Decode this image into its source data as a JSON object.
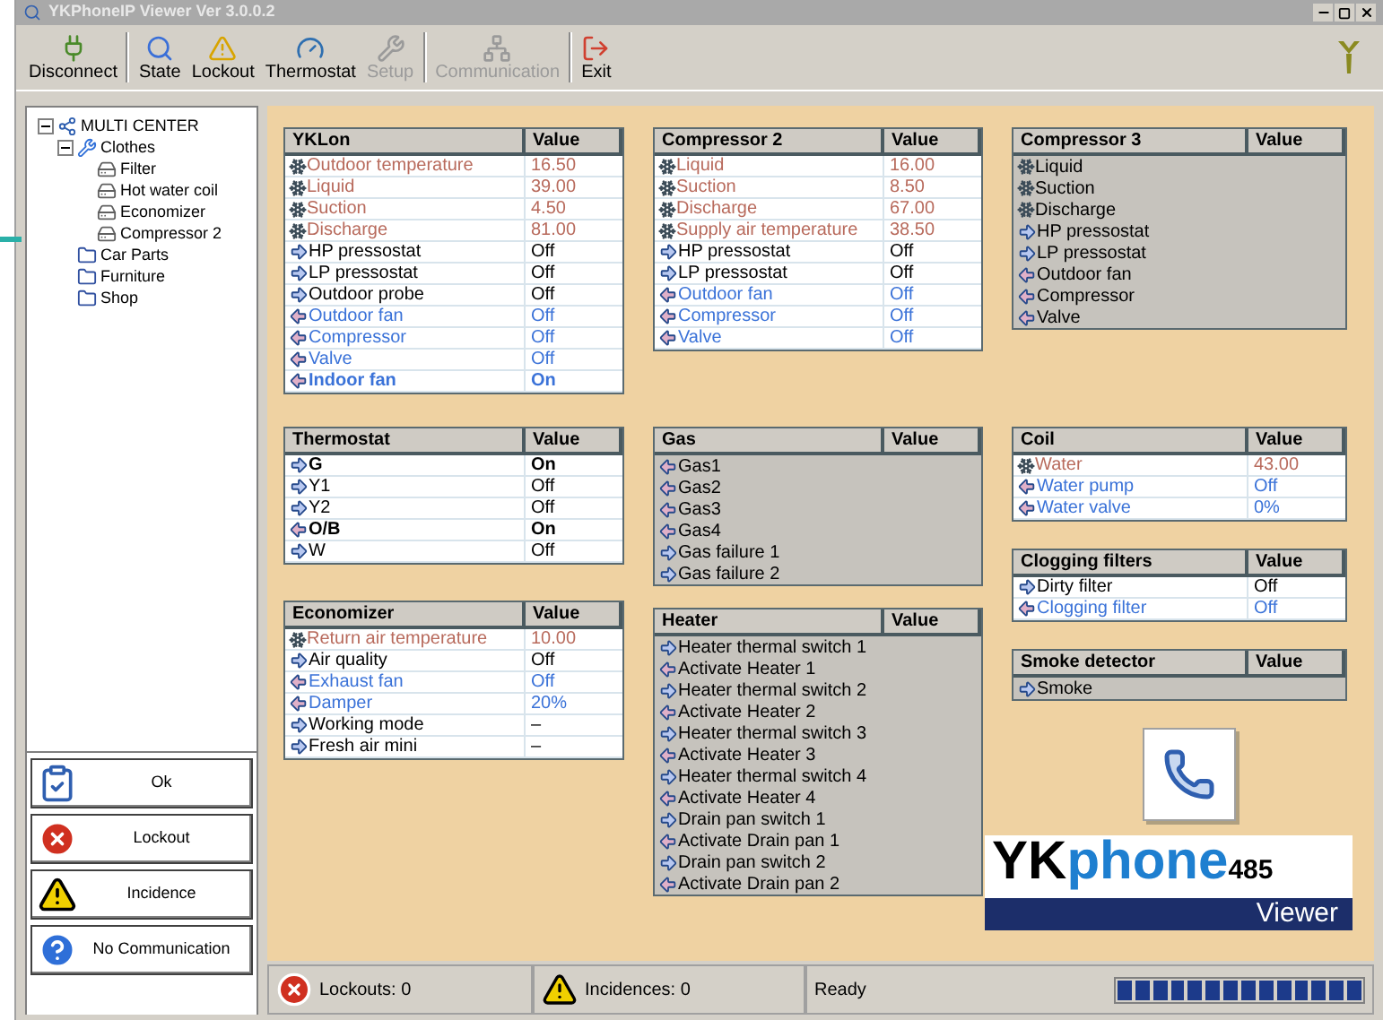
{
  "window": {
    "title": "YKPhoneIP Viewer Ver 3.0.0.2"
  },
  "toolbar": [
    {
      "label": "Disconnect",
      "kind": "disconnect",
      "disabled": false,
      "separator_after": true
    },
    {
      "label": "State",
      "kind": "state",
      "disabled": false,
      "separator_after": false
    },
    {
      "label": "Lockout",
      "kind": "lockout",
      "disabled": false,
      "separator_after": false
    },
    {
      "label": "Thermostat",
      "kind": "thermostat",
      "disabled": false,
      "separator_after": false
    },
    {
      "label": "Setup",
      "kind": "setup",
      "disabled": true,
      "separator_after": true
    },
    {
      "label": "Communication",
      "kind": "communication",
      "disabled": true,
      "separator_after": true
    },
    {
      "label": "Exit",
      "kind": "exit",
      "disabled": false,
      "separator_after": false
    }
  ],
  "tree": [
    {
      "label": "MULTI CENTER",
      "kind": "root",
      "expanded": true,
      "children": [
        {
          "label": "Clothes",
          "kind": "group",
          "expanded": true,
          "children": [
            {
              "label": "Filter",
              "kind": "device"
            },
            {
              "label": "Hot water coil",
              "kind": "device"
            },
            {
              "label": "Economizer",
              "kind": "device"
            },
            {
              "label": "Compressor 2",
              "kind": "device"
            }
          ]
        },
        {
          "label": "Car Parts",
          "kind": "site"
        },
        {
          "label": "Furniture",
          "kind": "site"
        },
        {
          "label": "Shop",
          "kind": "site"
        }
      ]
    }
  ],
  "side_buttons": [
    {
      "label": "Ok",
      "kind": "ok"
    },
    {
      "label": "Lockout",
      "kind": "lockout"
    },
    {
      "label": "Incidence",
      "kind": "incidence"
    },
    {
      "label": "No Communication",
      "kind": "nocomm"
    }
  ],
  "top_panels": [
    {
      "title": "YKLon",
      "value_header": "Value",
      "offline": false,
      "rows": [
        {
          "label": "Outdoor temperature",
          "value": "16.50",
          "kind": "sensor",
          "color": "#b86a5c",
          "bold": false
        },
        {
          "label": "Liquid",
          "value": "39.00",
          "kind": "sensor",
          "color": "#b86a5c",
          "bold": false
        },
        {
          "label": "Suction",
          "value": "4.50",
          "kind": "sensor",
          "color": "#b86a5c",
          "bold": false
        },
        {
          "label": "Discharge",
          "value": "81.00",
          "kind": "sensor",
          "color": "#b86a5c",
          "bold": false
        },
        {
          "label": "HP pressostat",
          "value": "Off",
          "kind": "input",
          "color": "#000000",
          "bold": false
        },
        {
          "label": "LP pressostat",
          "value": "Off",
          "kind": "input",
          "color": "#000000",
          "bold": false
        },
        {
          "label": "Outdoor probe",
          "value": "Off",
          "kind": "input",
          "color": "#000000",
          "bold": false
        },
        {
          "label": "Outdoor fan",
          "value": "Off",
          "kind": "output",
          "color": "#3a72d8",
          "bold": false
        },
        {
          "label": "Compressor",
          "value": "Off",
          "kind": "output",
          "color": "#3a72d8",
          "bold": false
        },
        {
          "label": "Valve",
          "value": "Off",
          "kind": "output",
          "color": "#3a72d8",
          "bold": false
        },
        {
          "label": "Indoor fan",
          "value": "On",
          "kind": "output",
          "color": "#3a72d8",
          "bold": true
        }
      ]
    },
    {
      "title": "Compressor 2",
      "value_header": "Value",
      "offline": false,
      "rows": [
        {
          "label": "Liquid",
          "value": "16.00",
          "kind": "sensor",
          "color": "#b86a5c",
          "bold": false
        },
        {
          "label": "Suction",
          "value": "8.50",
          "kind": "sensor",
          "color": "#b86a5c",
          "bold": false
        },
        {
          "label": "Discharge",
          "value": "67.00",
          "kind": "sensor",
          "color": "#b86a5c",
          "bold": false
        },
        {
          "label": "Supply air temperature",
          "value": "38.50",
          "kind": "sensor",
          "color": "#b86a5c",
          "bold": false
        },
        {
          "label": "HP pressostat",
          "value": "Off",
          "kind": "input",
          "color": "#000000",
          "bold": false
        },
        {
          "label": "LP pressostat",
          "value": "Off",
          "kind": "input",
          "color": "#000000",
          "bold": false
        },
        {
          "label": "Outdoor fan",
          "value": "Off",
          "kind": "output",
          "color": "#3a72d8",
          "bold": false
        },
        {
          "label": "Compressor",
          "value": "Off",
          "kind": "output",
          "color": "#3a72d8",
          "bold": false
        },
        {
          "label": "Valve",
          "value": "Off",
          "kind": "output",
          "color": "#3a72d8",
          "bold": false
        }
      ]
    },
    {
      "title": "Compressor 3",
      "value_header": "Value",
      "offline": true,
      "rows": [
        {
          "label": "Liquid",
          "kind": "sensor",
          "color": "#000000",
          "bold": false
        },
        {
          "label": "Suction",
          "kind": "sensor",
          "color": "#000000",
          "bold": false
        },
        {
          "label": "Discharge",
          "kind": "sensor",
          "color": "#000000",
          "bold": false
        },
        {
          "label": "HP pressostat",
          "kind": "input",
          "color": "#000000",
          "bold": false
        },
        {
          "label": "LP pressostat",
          "kind": "input",
          "color": "#000000",
          "bold": false
        },
        {
          "label": "Outdoor fan",
          "kind": "output",
          "color": "#000000",
          "bold": false
        },
        {
          "label": "Compressor",
          "kind": "output",
          "color": "#000000",
          "bold": false
        },
        {
          "label": "Valve",
          "kind": "output",
          "color": "#000000",
          "bold": false
        }
      ]
    }
  ],
  "lower_columns": [
    {
      "panels": [
        {
          "title": "Thermostat",
          "value_header": "Value",
          "offline": false,
          "rows": [
            {
              "label": "G",
              "value": "On",
              "kind": "input",
              "color": "#000000",
              "bold": true
            },
            {
              "label": "Y1",
              "value": "Off",
              "kind": "input",
              "color": "#000000",
              "bold": false
            },
            {
              "label": "Y2",
              "value": "Off",
              "kind": "input",
              "color": "#000000",
              "bold": false
            },
            {
              "label": "O/B",
              "value": "On",
              "kind": "output",
              "color": "#000000",
              "bold": true
            },
            {
              "label": "W",
              "value": "Off",
              "kind": "input",
              "color": "#000000",
              "bold": false
            }
          ]
        },
        {
          "title": "Economizer",
          "value_header": "Value",
          "offline": false,
          "rows": [
            {
              "label": "Return air temperature",
              "value": "10.00",
              "kind": "sensor",
              "color": "#b86a5c",
              "bold": false
            },
            {
              "label": "Air quality",
              "value": "Off",
              "kind": "input",
              "color": "#000000",
              "bold": false
            },
            {
              "label": "Exhaust fan",
              "value": "Off",
              "kind": "output",
              "color": "#3a72d8",
              "bold": false
            },
            {
              "label": "Damper",
              "value": "20%",
              "kind": "output",
              "color": "#3a72d8",
              "bold": false
            },
            {
              "label": "Working mode",
              "value": "–",
              "kind": "input",
              "color": "#000000",
              "bold": false
            },
            {
              "label": "Fresh air mini",
              "value": "–",
              "kind": "input",
              "color": "#000000",
              "bold": false
            }
          ]
        }
      ]
    },
    {
      "panels": [
        {
          "title": "Gas",
          "value_header": "Value",
          "offline": true,
          "rows": [
            {
              "label": "Gas1",
              "kind": "output",
              "color": "#000000",
              "bold": false
            },
            {
              "label": "Gas2",
              "kind": "output",
              "color": "#000000",
              "bold": false
            },
            {
              "label": "Gas3",
              "kind": "output",
              "color": "#000000",
              "bold": false
            },
            {
              "label": "Gas4",
              "kind": "output",
              "color": "#000000",
              "bold": false
            },
            {
              "label": "Gas failure 1",
              "kind": "input",
              "color": "#000000",
              "bold": false
            },
            {
              "label": "Gas failure 2",
              "kind": "input",
              "color": "#000000",
              "bold": false
            }
          ]
        },
        {
          "title": "Heater",
          "value_header": "Value",
          "offline": true,
          "rows": [
            {
              "label": "Heater thermal switch 1",
              "kind": "input",
              "color": "#000000",
              "bold": false
            },
            {
              "label": "Activate Heater 1",
              "kind": "output",
              "color": "#000000",
              "bold": false
            },
            {
              "label": "Heater thermal switch 2",
              "kind": "input",
              "color": "#000000",
              "bold": false
            },
            {
              "label": "Activate Heater 2",
              "kind": "output",
              "color": "#000000",
              "bold": false
            },
            {
              "label": "Heater thermal switch 3",
              "kind": "input",
              "color": "#000000",
              "bold": false
            },
            {
              "label": "Activate Heater 3",
              "kind": "output",
              "color": "#000000",
              "bold": false
            },
            {
              "label": "Heater thermal switch 4",
              "kind": "input",
              "color": "#000000",
              "bold": false
            },
            {
              "label": "Activate Heater 4",
              "kind": "output",
              "color": "#000000",
              "bold": false
            },
            {
              "label": "Drain pan switch 1",
              "kind": "input",
              "color": "#000000",
              "bold": false
            },
            {
              "label": "Activate Drain pan 1",
              "kind": "output",
              "color": "#000000",
              "bold": false
            },
            {
              "label": "Drain pan switch 2",
              "kind": "input",
              "color": "#000000",
              "bold": false
            },
            {
              "label": "Activate Drain pan 2",
              "kind": "output",
              "color": "#000000",
              "bold": false
            }
          ]
        }
      ]
    },
    {
      "panels": [
        {
          "title": "Coil",
          "value_header": "Value",
          "offline": false,
          "rows": [
            {
              "label": "Water",
              "value": "43.00",
              "kind": "sensor",
              "color": "#b86a5c",
              "bold": false
            },
            {
              "label": "Water pump",
              "value": "Off",
              "kind": "output",
              "color": "#3a72d8",
              "bold": false
            },
            {
              "label": "Water valve",
              "value": "0%",
              "kind": "output",
              "color": "#3a72d8",
              "bold": false
            }
          ]
        },
        {
          "title": "Clogging filters",
          "value_header": "Value",
          "offline": false,
          "rows": [
            {
              "label": "Dirty filter",
              "value": "Off",
              "kind": "input",
              "color": "#000000",
              "bold": false
            },
            {
              "label": "Clogging filter",
              "value": "Off",
              "kind": "output",
              "color": "#3a72d8",
              "bold": false
            }
          ]
        },
        {
          "title": "Smoke detector",
          "value_header": "Value",
          "offline": true,
          "rows": [
            {
              "label": "Smoke",
              "kind": "input",
              "color": "#000000",
              "bold": false
            }
          ]
        }
      ]
    }
  ],
  "logo": {
    "parts": [
      "YK",
      "phone",
      "485"
    ],
    "subtitle": "Viewer"
  },
  "status_bar": {
    "lockouts": "Lockouts: 0",
    "incidences": "Incidences: 0",
    "message": "Ready",
    "progress": {
      "level": 1
    }
  }
}
